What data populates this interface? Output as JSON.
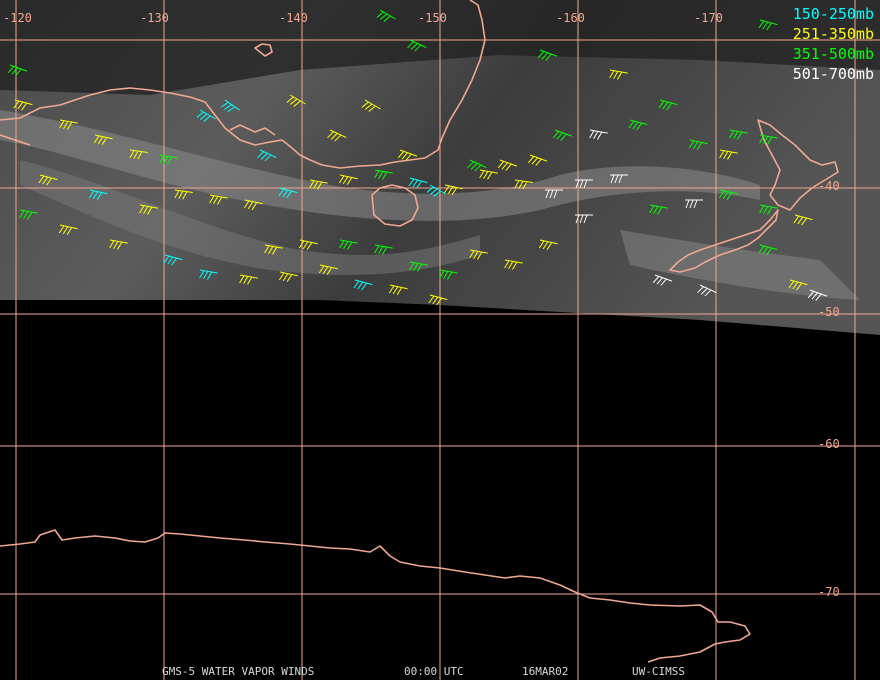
{
  "map": {
    "colors": {
      "grid": "#f0a890",
      "coast": "#f0a890",
      "background": "#000000",
      "imagery": "#3a3a3a"
    },
    "lon_labels": [
      "-120",
      "-130",
      "-140",
      "-150",
      "-160",
      "-170"
    ],
    "lat_labels": [
      "-40",
      "-50",
      "-60",
      "-70"
    ]
  },
  "legend": [
    {
      "label": "150-250mb",
      "color": "#00ffff"
    },
    {
      "label": "251-350mb",
      "color": "#ffff00"
    },
    {
      "label": "351-500mb",
      "color": "#00ff00"
    },
    {
      "label": "501-700mb",
      "color": "#ffffff"
    }
  ],
  "footer": {
    "product": "GMS-5 WATER VAPOR WINDS",
    "time": "00:00 UTC",
    "date": "16MAR02",
    "source": "UW-CIMSS"
  }
}
